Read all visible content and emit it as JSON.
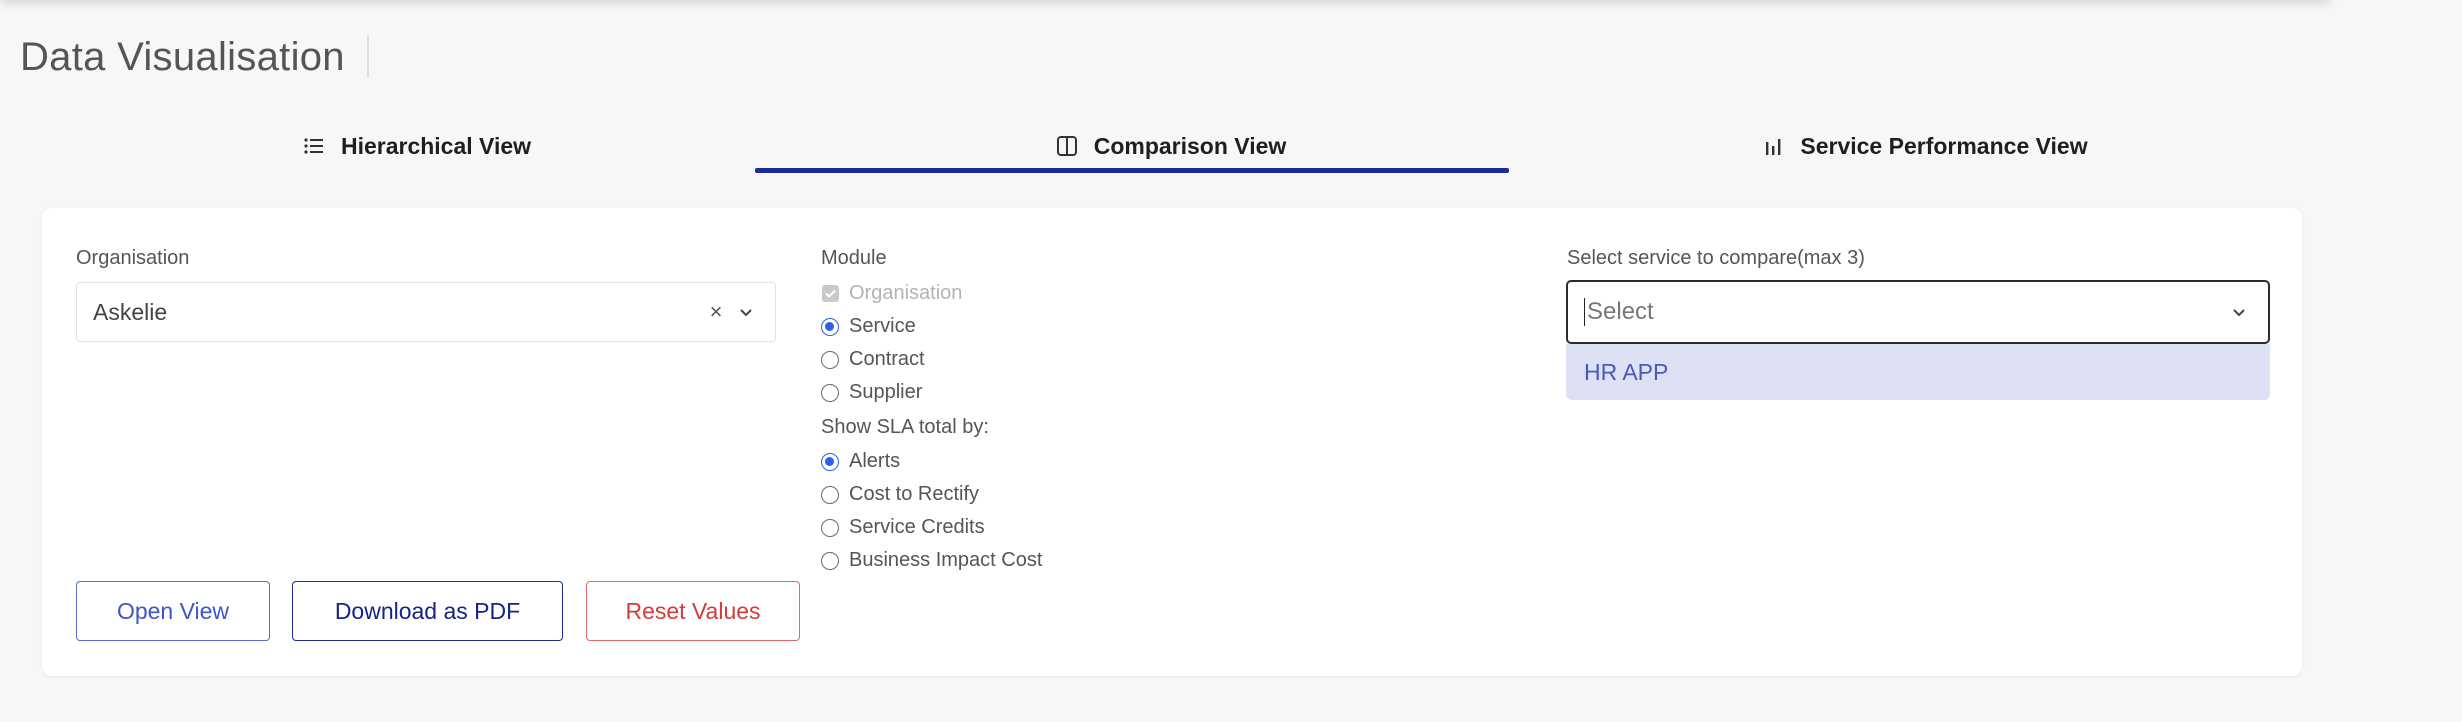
{
  "page": {
    "title": "Data Visualisation"
  },
  "tabs": [
    {
      "label": "Hierarchical View",
      "icon": "list-icon",
      "active": false
    },
    {
      "label": "Comparison View",
      "icon": "columns-icon",
      "active": true
    },
    {
      "label": "Service Performance View",
      "icon": "bar-chart-icon",
      "active": false
    }
  ],
  "organisation": {
    "label": "Organisation",
    "value": "Askelie",
    "clear_glyph": "×"
  },
  "module": {
    "label": "Module",
    "options": [
      {
        "label": "Organisation",
        "type": "checkbox",
        "checked": true,
        "disabled": true
      },
      {
        "label": "Service",
        "type": "radio",
        "checked": true
      },
      {
        "label": "Contract",
        "type": "radio",
        "checked": false
      },
      {
        "label": "Supplier",
        "type": "radio",
        "checked": false
      }
    ]
  },
  "sla": {
    "label": "Show SLA total by:",
    "options": [
      {
        "label": "Alerts",
        "checked": true
      },
      {
        "label": "Cost to Rectify",
        "checked": false
      },
      {
        "label": "Service Credits",
        "checked": false
      },
      {
        "label": "Business Impact Cost",
        "checked": false
      }
    ]
  },
  "compare": {
    "label": "Select service to compare(max 3)",
    "placeholder": "Select",
    "dropdown_items": [
      "HR APP"
    ]
  },
  "buttons": {
    "open": "Open View",
    "pdf": "Download as PDF",
    "reset": "Reset Values"
  },
  "colors": {
    "accent": "#1e2a9a",
    "radio": "#2f5fe8",
    "danger": "#d63a3a",
    "dropdown_highlight": "#dde1f3"
  }
}
